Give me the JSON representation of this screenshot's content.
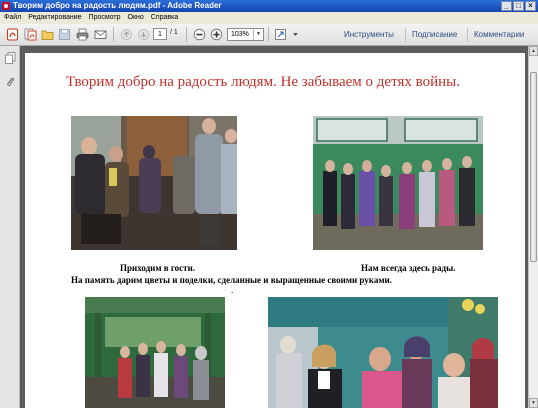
{
  "window": {
    "title": "Творим добро на радость людям.pdf - Adobe Reader",
    "minimize": "_",
    "maximize": "□",
    "close": "×"
  },
  "menu": [
    "Файл",
    "Редактирование",
    "Просмотр",
    "Окно",
    "Справка"
  ],
  "toolbar": {
    "page_current": "1",
    "page_total": "/ 1",
    "zoom": "103%",
    "links": [
      "Инструменты",
      "Подписание",
      "Комментарии"
    ]
  },
  "document": {
    "heading": "Творим добро на радость людям. Не забываем о детях войны.",
    "caption_left": "Приходим в гости.",
    "caption_right": "Нам всегда здесь рады.",
    "caption_main": "На память дарим цветы и поделки, сделанные и выращенные своими руками.",
    "dot": "."
  },
  "colors": {
    "heading": "#c0302a",
    "title_bar": "#1c55c4",
    "link": "#2e4e7e"
  }
}
